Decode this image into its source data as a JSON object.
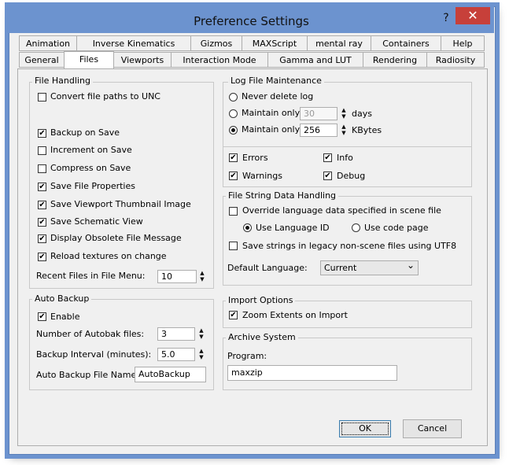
{
  "window": {
    "title": "Preference Settings",
    "help_glyph": "?",
    "close_glyph": "✕"
  },
  "tabs_row1": [
    "Animation",
    "Inverse Kinematics",
    "Gizmos",
    "MAXScript",
    "mental ray",
    "Containers",
    "Help"
  ],
  "tabs_row2": [
    "General",
    "Files",
    "Viewports",
    "Interaction Mode",
    "Gamma and LUT",
    "Rendering",
    "Radiosity"
  ],
  "active_tab": "Files",
  "file_handling": {
    "title": "File Handling",
    "convert_unc": {
      "label": "Convert file paths to UNC",
      "checked": false
    },
    "backup_on_save": {
      "label": "Backup on Save",
      "checked": true
    },
    "increment_on_save": {
      "label": "Increment on Save",
      "checked": false
    },
    "compress_on_save": {
      "label": "Compress on Save",
      "checked": false
    },
    "save_file_properties": {
      "label": "Save File Properties",
      "checked": true
    },
    "save_viewport_thumbnail": {
      "label": "Save Viewport Thumbnail Image",
      "checked": true
    },
    "save_schematic_view": {
      "label": "Save Schematic View",
      "checked": true
    },
    "display_obsolete": {
      "label": "Display Obsolete File Message",
      "checked": true
    },
    "reload_textures": {
      "label": "Reload textures on change",
      "checked": true
    },
    "recent_files": {
      "label": "Recent Files in File Menu:",
      "value": "10"
    }
  },
  "auto_backup": {
    "title": "Auto Backup",
    "enable": {
      "label": "Enable",
      "checked": true
    },
    "num_files": {
      "label": "Number of Autobak files:",
      "value": "3"
    },
    "interval": {
      "label": "Backup Interval (minutes):",
      "value": "5.0"
    },
    "file_name": {
      "label": "Auto Backup File Name:",
      "value": "AutoBackup"
    }
  },
  "log_file": {
    "title": "Log File Maintenance",
    "never_delete": "Never delete log",
    "maintain_days": {
      "label": "Maintain only",
      "value": "30",
      "unit": "days"
    },
    "maintain_kb": {
      "label": "Maintain only",
      "value": "256",
      "unit": "KBytes"
    },
    "errors": {
      "label": "Errors",
      "checked": true
    },
    "info": {
      "label": "Info",
      "checked": true
    },
    "warnings": {
      "label": "Warnings",
      "checked": true
    },
    "debug": {
      "label": "Debug",
      "checked": true
    }
  },
  "file_string": {
    "title": "File String Data Handling",
    "override": {
      "label": "Override language data specified in scene file",
      "checked": false
    },
    "use_language_id": "Use Language ID",
    "use_code_page": "Use code page",
    "save_utf8": {
      "label": "Save strings in legacy non-scene files using UTF8",
      "checked": false
    },
    "default_language": {
      "label": "Default Language:",
      "value": "Current"
    }
  },
  "import_options": {
    "title": "Import Options",
    "zoom_extents": {
      "label": "Zoom Extents on Import",
      "checked": true
    }
  },
  "archive": {
    "title": "Archive System",
    "program_label": "Program:",
    "program_value": "maxzip"
  },
  "buttons": {
    "ok": "OK",
    "cancel": "Cancel"
  },
  "check_glyph": "✔",
  "spin_up": "▲",
  "spin_down": "▼",
  "dropdown_arrow": "⌄"
}
